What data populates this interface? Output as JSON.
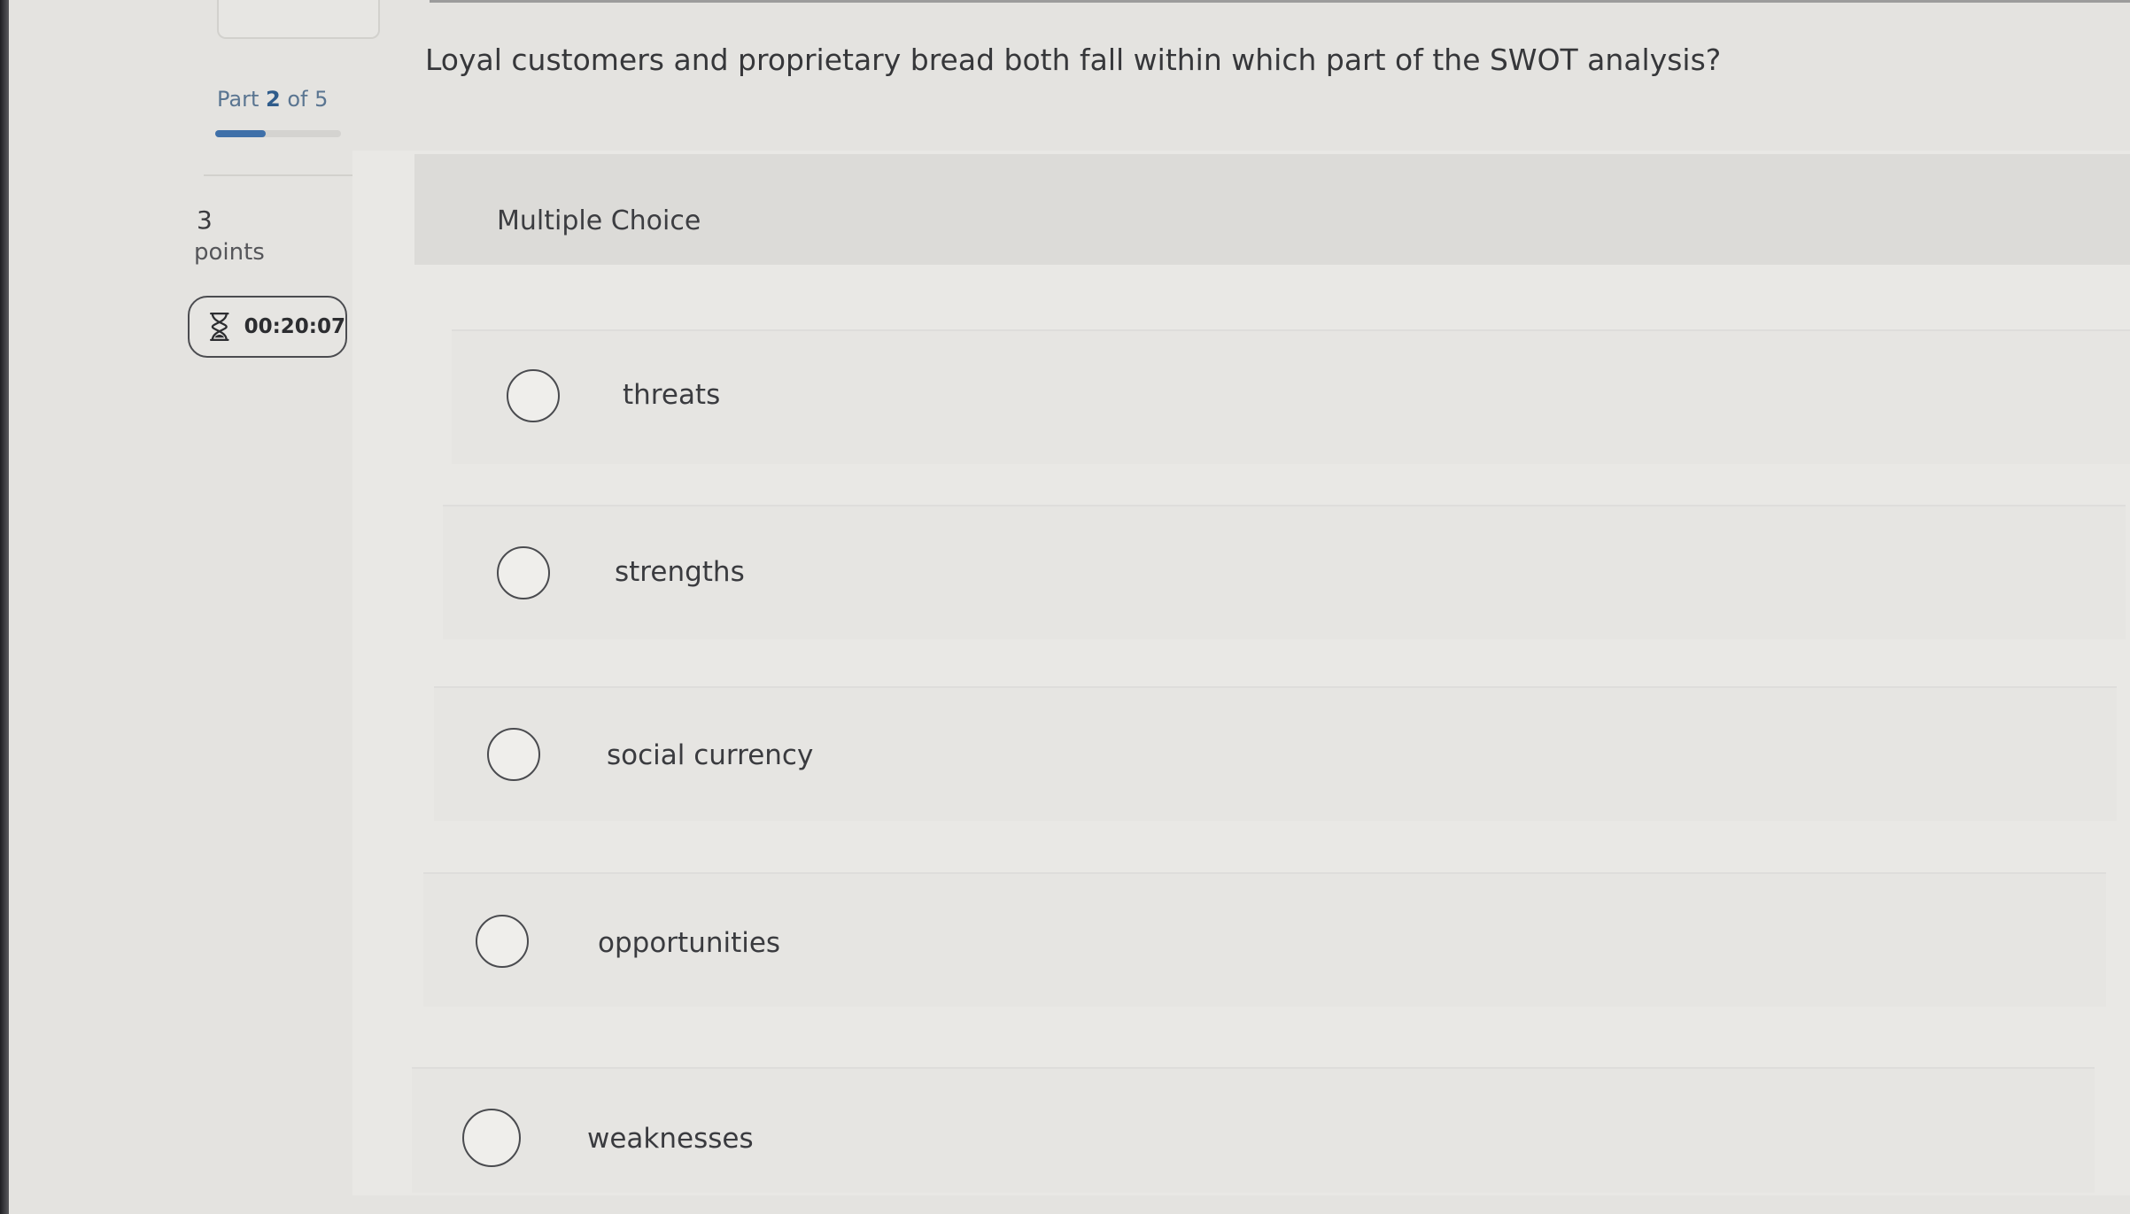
{
  "quiz": {
    "part": {
      "prefix": "Part",
      "current": "2",
      "of_text": "of 5",
      "progress_fraction": 0.4
    },
    "points": {
      "value": "3",
      "label": "points"
    },
    "timer": {
      "time": "00:20:07",
      "icon": "hourglass-icon"
    },
    "question": "Loyal customers and proprietary bread both fall within which part of the SWOT analysis?",
    "question_type": "Multiple Choice",
    "options": [
      {
        "label": "threats"
      },
      {
        "label": "strengths"
      },
      {
        "label": "social currency"
      },
      {
        "label": "opportunities"
      },
      {
        "label": "weaknesses"
      }
    ]
  },
  "colors": {
    "accent": "#3f70a9",
    "part_text": "#2f5c8b",
    "background": "#e4e3e0"
  }
}
